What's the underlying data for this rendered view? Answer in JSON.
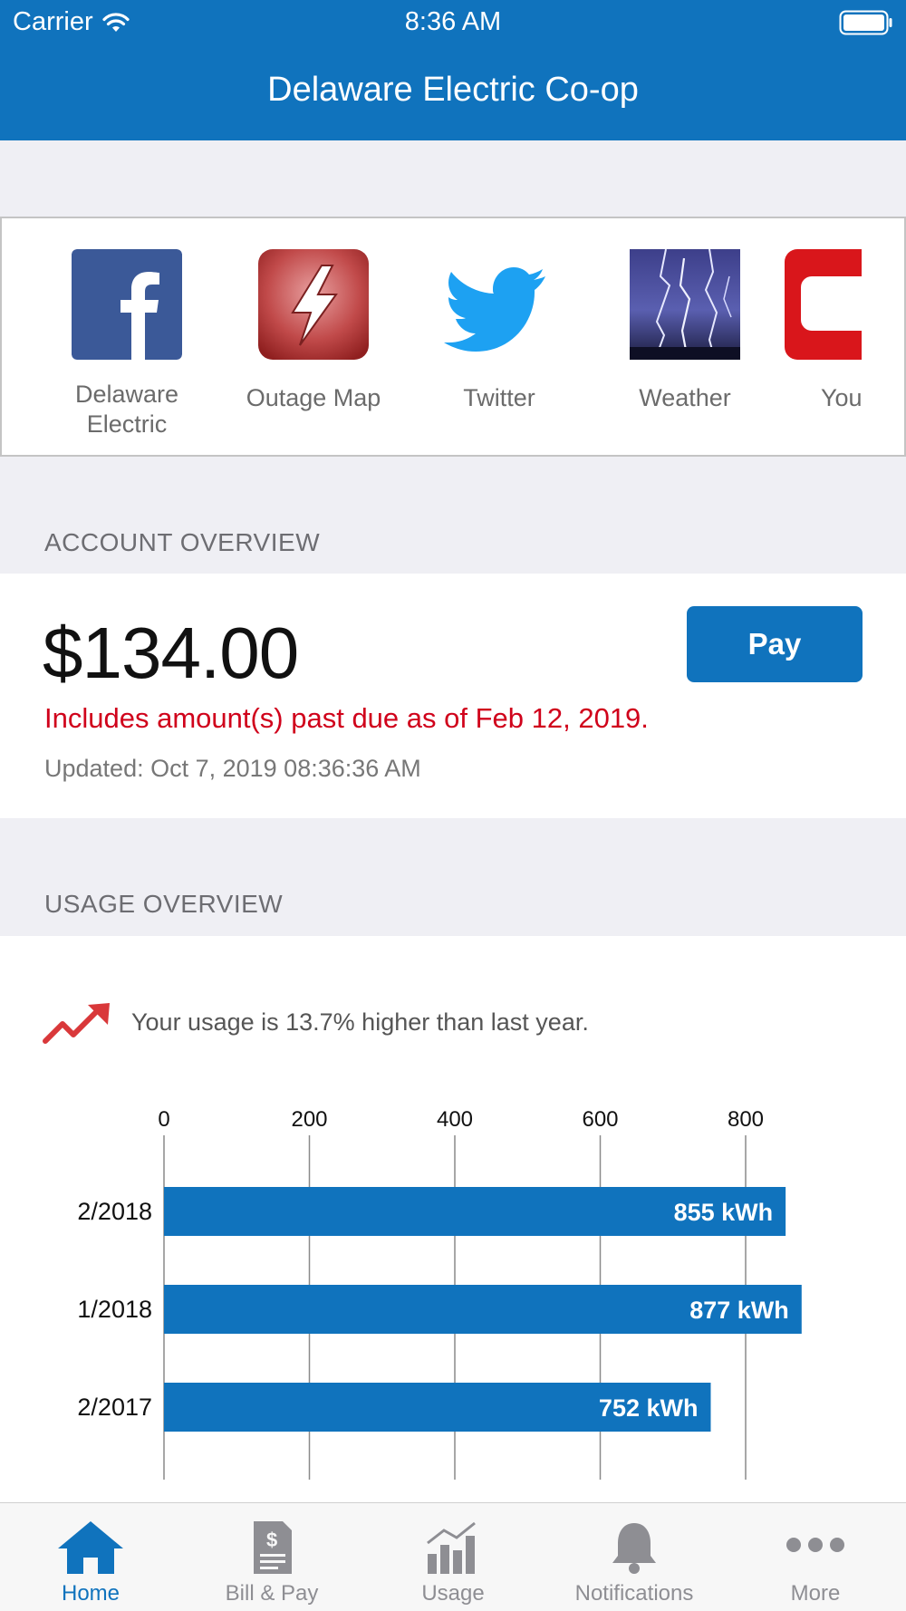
{
  "status_bar": {
    "carrier": "Carrier",
    "time": "8:36 AM",
    "icons": [
      "wifi-icon",
      "battery-icon"
    ]
  },
  "header": {
    "title": "Delaware Electric Co-op"
  },
  "quick_links": [
    {
      "label": "Delaware Electric",
      "icon": "facebook-icon"
    },
    {
      "label": "Outage Map",
      "icon": "lightning-bolt-icon"
    },
    {
      "label": "Twitter",
      "icon": "twitter-icon"
    },
    {
      "label": "Weather",
      "icon": "storm-weather-icon"
    },
    {
      "label": "You",
      "icon": "youtube-icon"
    }
  ],
  "account": {
    "section_title": "ACCOUNT OVERVIEW",
    "amount": "$134.00",
    "pay_label": "Pay",
    "past_due_notice": "Includes amount(s) past due as of Feb 12, 2019.",
    "updated": "Updated: Oct 7, 2019 08:36:36 AM"
  },
  "usage": {
    "section_title": "USAGE OVERVIEW",
    "trend_text": "Your usage is 13.7% higher than last year.",
    "trend_icon": "trend-up-icon"
  },
  "chart_data": {
    "type": "bar",
    "orientation": "horizontal",
    "categories": [
      "2/2018",
      "1/2018",
      "2/2017"
    ],
    "values": [
      855,
      877,
      752
    ],
    "value_labels": [
      "855 kWh",
      "877 kWh",
      "752 kWh"
    ],
    "x_ticks": [
      "0",
      "200",
      "400",
      "600",
      "800"
    ],
    "xlim": [
      0,
      880
    ],
    "grid": true,
    "bar_color": "#1073bd"
  },
  "tabs": [
    {
      "label": "Home",
      "icon": "home-icon",
      "active": true
    },
    {
      "label": "Bill & Pay",
      "icon": "bill-icon",
      "active": false
    },
    {
      "label": "Usage",
      "icon": "usage-chart-icon",
      "active": false
    },
    {
      "label": "Notifications",
      "icon": "bell-icon",
      "active": false
    },
    {
      "label": "More",
      "icon": "more-dots-icon",
      "active": false
    }
  ],
  "colors": {
    "brand": "#1073bd",
    "alert": "#d0021b",
    "tab_inactive": "#8e8e93"
  }
}
